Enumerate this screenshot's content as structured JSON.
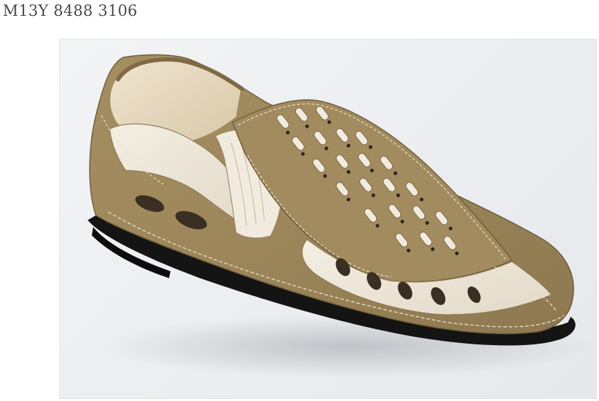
{
  "product": {
    "code": "M13Y 8488 3106"
  },
  "image": {
    "subject": "shoe",
    "colors": {
      "nubuck": "#a08a5f",
      "nubuck_dark": "#7e6a45",
      "leather_white": "#efe9dc",
      "sole": "#141414",
      "background": "#eceef1"
    }
  }
}
